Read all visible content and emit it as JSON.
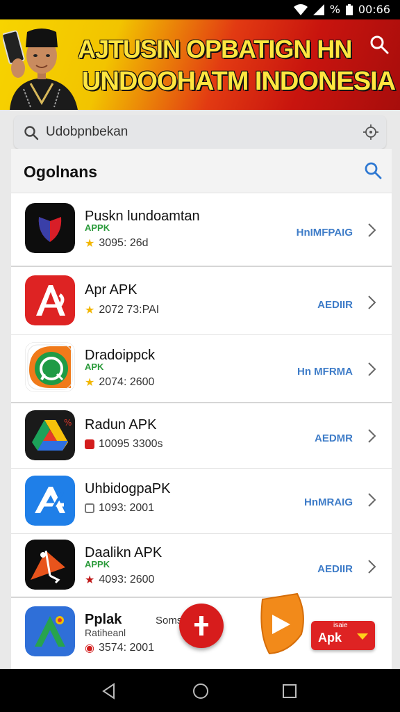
{
  "status_bar": {
    "time": "00:66",
    "percent": "%"
  },
  "banner": {
    "title_line1": "AJTUSIN OPBATIGN HN",
    "title_line2": "UNDOOHATM INDONESIA"
  },
  "search": {
    "value": "Udobpnbekan"
  },
  "panel": {
    "title": "Ogolnans"
  },
  "apps": [
    {
      "name": "Puskn lundoamtan",
      "tag": "APPK",
      "meta": "3095: 26d",
      "action": "HnIMFPAIG"
    },
    {
      "name": "Apr APK",
      "tag": "",
      "meta": "2072 73:PAI",
      "action": "AEDIIR"
    },
    {
      "name": "Dradoippck",
      "tag": "APK",
      "meta": "2074: 2600",
      "action": "Hn MFRMA"
    },
    {
      "name": "Radun APK",
      "tag": "",
      "meta": "10095 3300s",
      "action": "AEDMR"
    },
    {
      "name": "UhbidogpaPK",
      "tag": "",
      "meta": "1093: 2001",
      "action": "HnMRAIG"
    },
    {
      "name": "Daalikn APK",
      "tag": "APPK",
      "meta": "4093: 2600",
      "action": "AEDIIR"
    },
    {
      "name": "Pplak",
      "tag": "Ratiheanl",
      "meta": "3574: 2001",
      "action": "",
      "extra": "Soms"
    }
  ],
  "apk_button": {
    "small": "isaie",
    "label": "Apk"
  },
  "colors": {
    "accent": "#3e7cc8",
    "banner_red": "#c8140e",
    "banner_yellow": "#f7d400",
    "fab_red": "#d71c1c",
    "fab_orange": "#f28a1a"
  }
}
